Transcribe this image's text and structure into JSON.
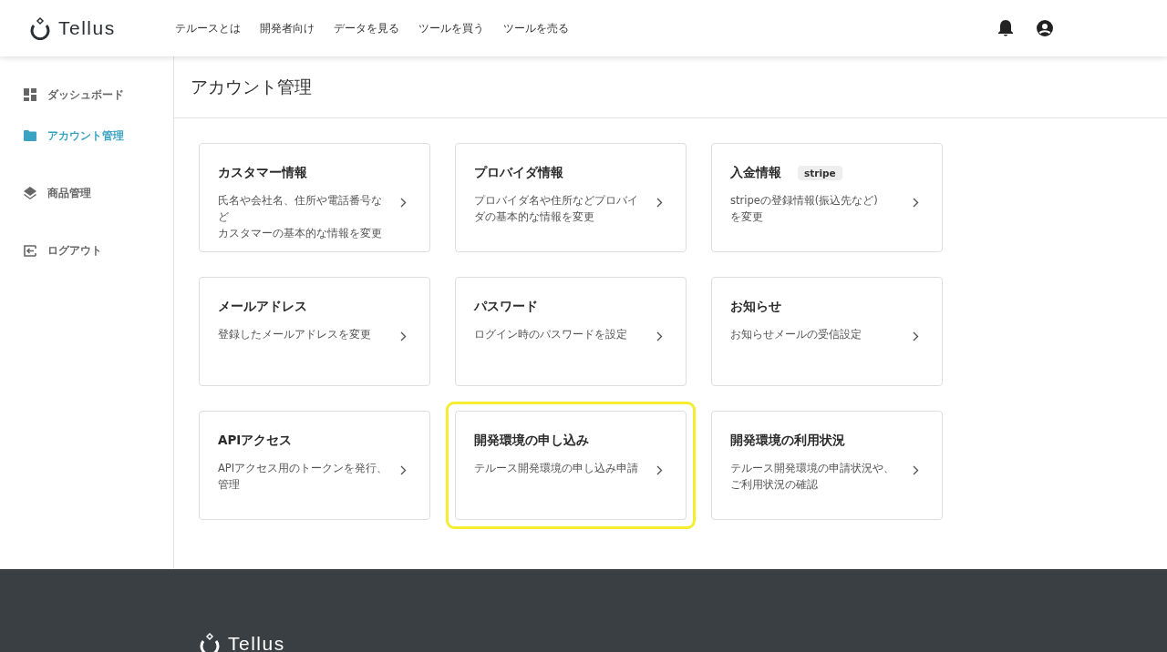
{
  "header": {
    "logo": "Tellus",
    "nav": [
      "テルースとは",
      "開発者向け",
      "データを見る",
      "ツールを買う",
      "ツールを売る"
    ]
  },
  "sidebar": {
    "items": [
      {
        "label": "ダッシュボード",
        "selected": false
      },
      {
        "label": "アカウント管理",
        "selected": true
      },
      {
        "label": "商品管理",
        "selected": false
      },
      {
        "label": "ログアウト",
        "selected": false
      }
    ]
  },
  "page_title": "アカウント管理",
  "cards": [
    {
      "title": "カスタマー情報",
      "description": [
        "氏名や会社名、住所や電話番号など",
        "カスタマーの基本的な情報を変更"
      ],
      "highlighted": false
    },
    {
      "title": "プロバイダ情報",
      "description": "プロバイダ名や住所などプロバイダの基本的な情報を変更",
      "highlighted": false
    },
    {
      "title": "入金情報",
      "badge": "stripe",
      "description": [
        "stripeの登録情報(振込先など)",
        "を変更"
      ],
      "highlighted": false
    },
    {
      "title": "メールアドレス",
      "description": "登録したメールアドレスを変更",
      "highlighted": false
    },
    {
      "title": "パスワード",
      "description": "ログイン時のパスワードを設定",
      "highlighted": false
    },
    {
      "title": "お知らせ",
      "description": "お知らせメールの受信設定",
      "highlighted": false
    },
    {
      "title": "APIアクセス",
      "description": "APIアクセス用のトークンを発行、管理",
      "highlighted": false
    },
    {
      "title": "開発環境の申し込み",
      "description": "テルース開発環境の申し込み申請",
      "highlighted": true
    },
    {
      "title": "開発環境の利用状況",
      "description": "テルース開発環境の申請状況や、ご利用状況の確認",
      "highlighted": false
    }
  ],
  "footer": {
    "logo": "Tellus"
  }
}
